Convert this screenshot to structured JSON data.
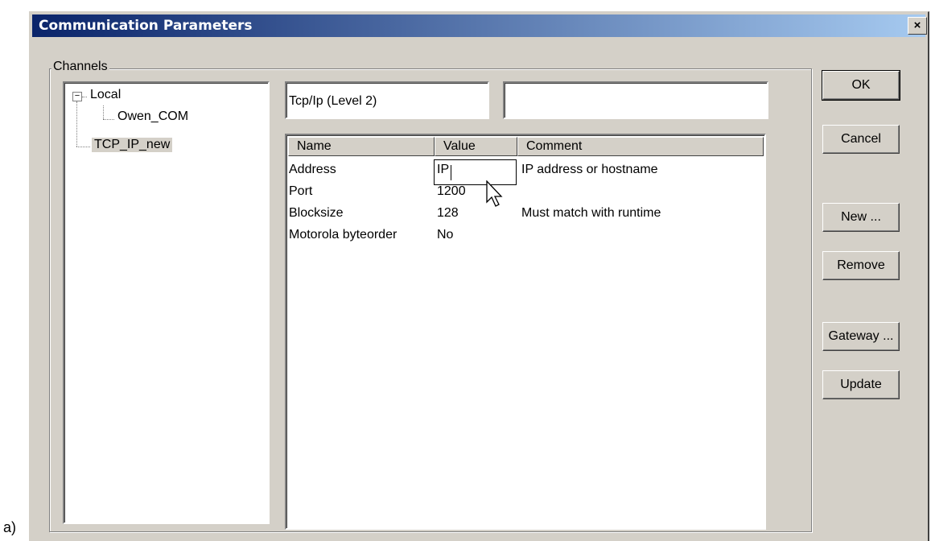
{
  "caption": "a)",
  "window": {
    "title": "Communication Parameters",
    "close_glyph": "×"
  },
  "channels": {
    "group_label": "Channels",
    "tree": [
      {
        "label": "Local",
        "expander": "−"
      },
      {
        "label": "Owen_COM"
      },
      {
        "label": "TCP_IP_new",
        "selected": true
      }
    ]
  },
  "driver_field": "Tcp/Ip (Level 2)",
  "second_field": "",
  "table": {
    "headers": [
      "Name",
      "Value",
      "Comment"
    ],
    "rows": [
      {
        "name": "Address",
        "value": "IP",
        "comment": "IP address or hostname"
      },
      {
        "name": "Port",
        "value": "1200",
        "comment": ""
      },
      {
        "name": "Blocksize",
        "value": "128",
        "comment": "Must match with runtime"
      },
      {
        "name": "Motorola byteorder",
        "value": "No",
        "comment": ""
      }
    ]
  },
  "buttons": {
    "ok": "OK",
    "cancel": "Cancel",
    "new": "New ...",
    "remove": "Remove",
    "gateway": "Gateway ...",
    "update": "Update"
  }
}
